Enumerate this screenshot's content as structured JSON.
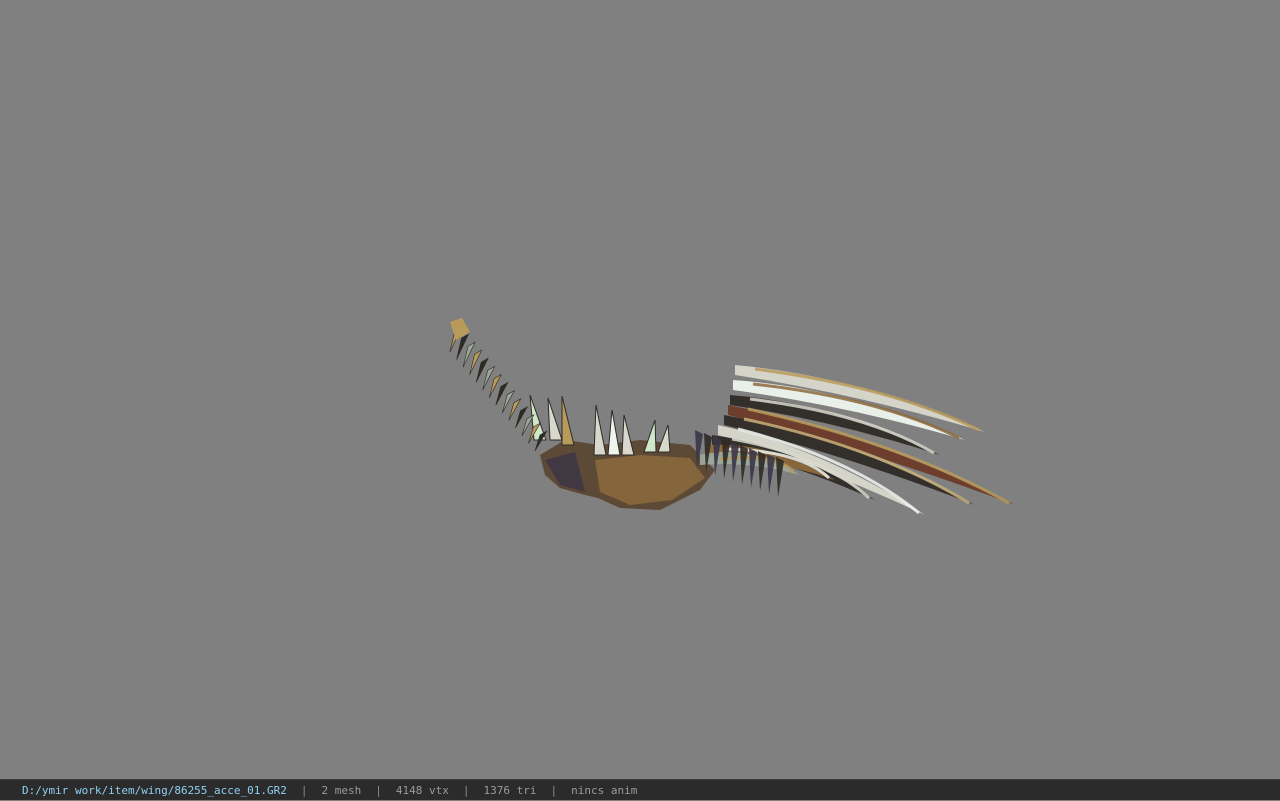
{
  "viewer": {
    "background_color": "#808080",
    "status_bar_color": "#2b2b2b",
    "path_color": "#8fd0f0"
  },
  "model": {
    "subject": "wing-model",
    "palette": [
      "#2e2a26",
      "#5a4632",
      "#8c6a3c",
      "#b89a5a",
      "#d8d8cc",
      "#eef4ee",
      "#6b3a28",
      "#3b3548",
      "#9aa89a",
      "#c7b07a"
    ]
  },
  "status": {
    "file_path": "D:/ymir work/item/wing/86255_acce_01.GR2",
    "separator": "|",
    "mesh_count": "2 mesh",
    "vertex_count": "4148 vtx",
    "triangle_count": "1376 tri",
    "animation": "nincs anim"
  }
}
